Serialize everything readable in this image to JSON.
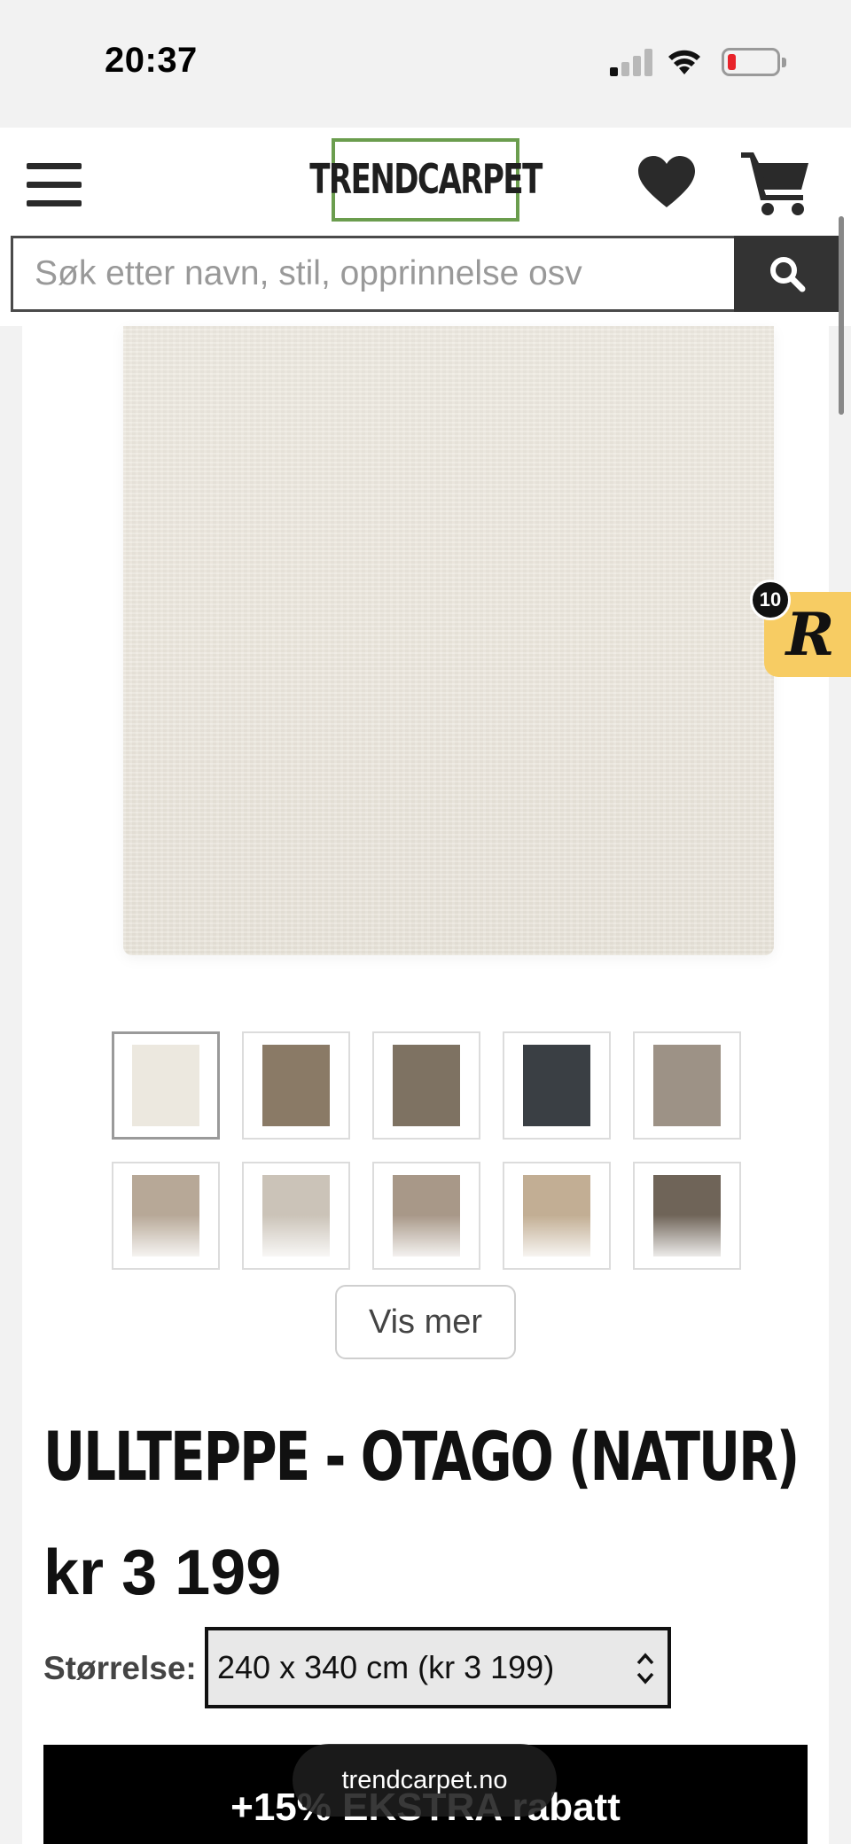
{
  "status_bar": {
    "time": "20:37"
  },
  "header": {
    "logo_text": "TRENDCARPET",
    "search": {
      "placeholder": "Søk etter navn, stil, opprinnelse osv",
      "value": ""
    }
  },
  "gallery": {
    "thumbnails": [
      {
        "name": "thumb-1",
        "tone": "#ece8df"
      },
      {
        "name": "thumb-2",
        "tone": "#8a7a66"
      },
      {
        "name": "thumb-3",
        "tone": "#7e7262"
      },
      {
        "name": "thumb-4",
        "tone": "#3a3f44"
      },
      {
        "name": "thumb-5",
        "tone": "#9d9286"
      },
      {
        "name": "thumb-6",
        "tone": "#b7a897"
      },
      {
        "name": "thumb-7",
        "tone": "#cbc3b8"
      },
      {
        "name": "thumb-8",
        "tone": "#a89888"
      },
      {
        "name": "thumb-9",
        "tone": "#c2ae94"
      },
      {
        "name": "thumb-10",
        "tone": "#6f6458"
      }
    ],
    "show_more_label": "Vis mer"
  },
  "product": {
    "title": "ULLTEPPE - OTAGO (NATUR)",
    "price": "kr 3 199",
    "size_label": "Størrelse:",
    "size_selected": "240 x 340 cm (kr 3 199)"
  },
  "promo": {
    "text": "+15% EKSTRA rabatt"
  },
  "browser": {
    "url": "trendcarpet.no"
  },
  "rewards": {
    "badge_count": "10",
    "glyph": "R"
  },
  "colors": {
    "logo_border": "#6b9d4e",
    "rewards_bg": "#f7cc63",
    "battery_low": "#e8232a"
  }
}
